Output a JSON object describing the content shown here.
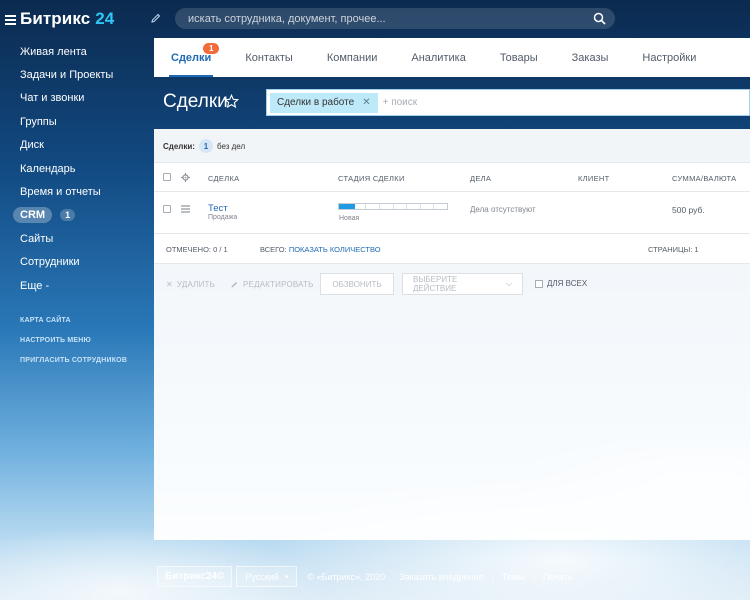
{
  "brand": {
    "name": "Битрикс",
    "num": "24"
  },
  "search": {
    "placeholder": "искать сотрудника, документ, прочее..."
  },
  "sidebar": {
    "items": [
      {
        "label": "Живая лента"
      },
      {
        "label": "Задачи и Проекты"
      },
      {
        "label": "Чат и звонки"
      },
      {
        "label": "Группы"
      },
      {
        "label": "Диск"
      },
      {
        "label": "Календарь"
      },
      {
        "label": "Время и отчеты"
      },
      {
        "label": "CRM",
        "count": "1"
      },
      {
        "label": "Сайты"
      },
      {
        "label": "Сотрудники"
      },
      {
        "label": "Еще -"
      }
    ],
    "links": [
      "Карта сайта",
      "Настроить меню",
      "Пригласить сотрудников"
    ]
  },
  "tabs": [
    {
      "label": "Сделки",
      "badge": "1"
    },
    {
      "label": "Контакты"
    },
    {
      "label": "Компании"
    },
    {
      "label": "Аналитика"
    },
    {
      "label": "Товары"
    },
    {
      "label": "Заказы"
    },
    {
      "label": "Настройки"
    }
  ],
  "page": {
    "title": "Сделки",
    "filter_chip": "Сделки в работе",
    "filter_placeholder": "+ поиск",
    "counter_label": "Сделки:",
    "counter_value": "1",
    "counter_suffix": "без дел"
  },
  "table": {
    "headers": [
      "Сделка",
      "Стадия сделки",
      "Дела",
      "Клиент",
      "Сумма/Валюта"
    ],
    "row": {
      "title": "Тест",
      "subtitle": "Продажа",
      "stage_label": "Новая",
      "stage_progress": 0.15,
      "deals": "Дела отсутствуют",
      "sum": "500 руб."
    },
    "footer": {
      "selected": "Отмечено: 0 / 1",
      "total_label": "Всего:",
      "total_link": "Показать количество",
      "pages": "Страницы: 1"
    }
  },
  "actions": {
    "delete": "Удалить",
    "edit": "Редактировать",
    "call": "Обзвонить",
    "select_action": "Выберите действие",
    "for_all": "Для всех"
  },
  "footer": {
    "logo": "Битрикс24©",
    "lang": "Русский",
    "copyright": "© «Битрикс», 2020",
    "order": "Заказать внедрение",
    "themes": "Темы",
    "print": "Печать"
  },
  "colors": {
    "accent": "#1f6ab5",
    "brand_num": "#2fc6f6",
    "badge": "#f36b3b",
    "stage_fill": "#1e9be2"
  }
}
